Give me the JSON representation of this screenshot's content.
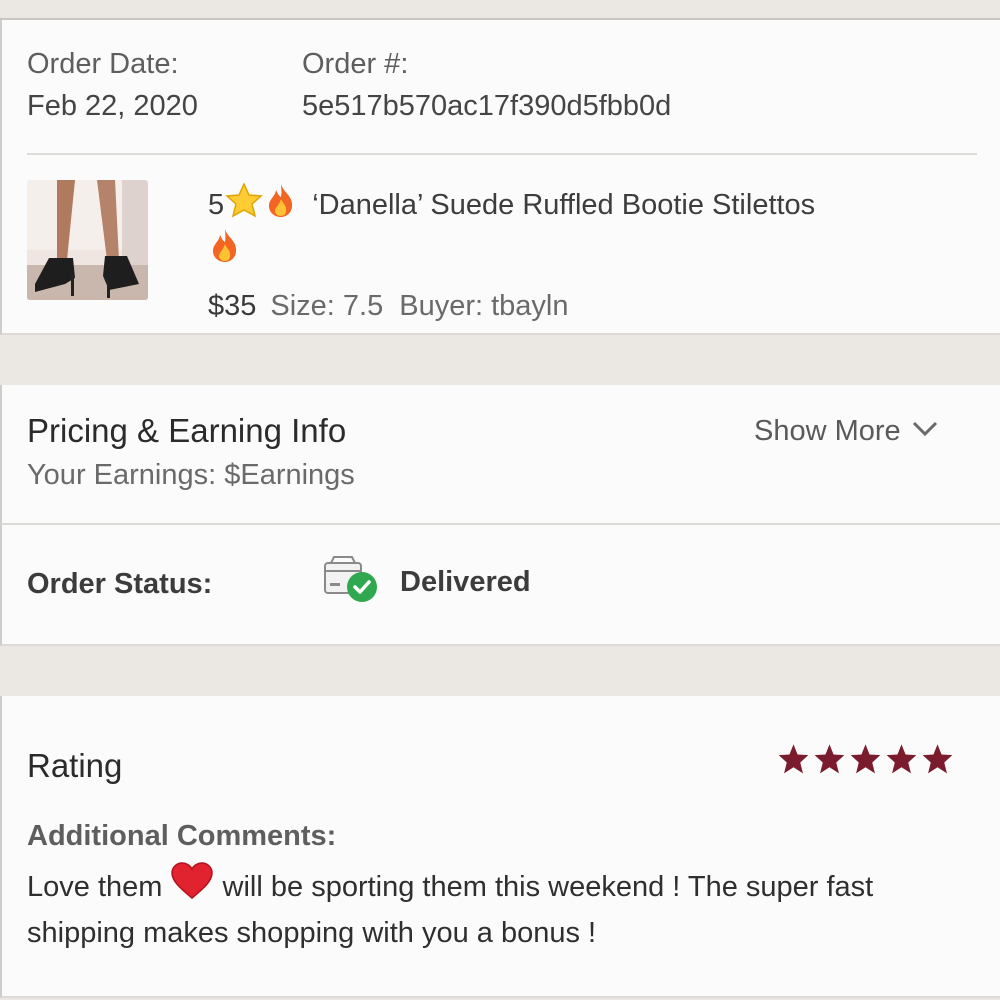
{
  "order": {
    "date_label": "Order Date:",
    "date_value": "Feb 22, 2020",
    "number_label": "Order #:",
    "number_value": "5e517b570ac17f390d5fbb0d"
  },
  "item": {
    "title_prefix": "5",
    "title_text": "‘Danella’ Suede Ruffled Bootie Stilettos",
    "price": "$35",
    "size": "Size: 7.5",
    "buyer": "Buyer: tbayln",
    "icons": [
      "star-emoji",
      "fire-emoji"
    ]
  },
  "pricing": {
    "title": "Pricing & Earning Info",
    "earnings": "Your Earnings: $Earnings",
    "show_more": "Show More"
  },
  "status": {
    "label": "Order Status:",
    "value": "Delivered",
    "color": "#2fa84f"
  },
  "rating": {
    "title": "Rating",
    "stars": 5,
    "star_color": "#7a1c2e",
    "comments_label": "Additional Comments:",
    "comment_part1": "Love them",
    "comment_part2": "will be sporting them this weekend ! The super fast shipping makes shopping with you a bonus !"
  }
}
